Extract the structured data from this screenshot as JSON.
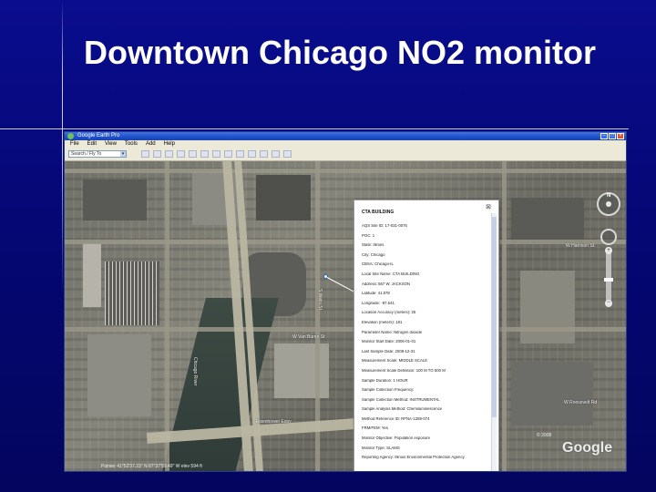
{
  "slide": {
    "title": "Downtown Chicago NO2 monitor"
  },
  "window": {
    "app_title": "Google Earth Pro",
    "menu": [
      "File",
      "Edit",
      "View",
      "Tools",
      "Add",
      "Help"
    ],
    "search_value": "Search / Fly To"
  },
  "map": {
    "labels": {
      "street_left": "S Wells St",
      "street_mid": "W Van Buren St",
      "expressway": "Eisenhower Expy",
      "street_right_top": "W Harrison St",
      "street_right_bottom": "W Roosevelt Rd",
      "river_label": "Chicago River"
    },
    "logo": "Google",
    "copyright": "© 2008",
    "status": "Pointer 41°52'37.23\" N  87°37'59.49\" W  elev 594 ft"
  },
  "balloon": {
    "site_name": "CTA BUILDING",
    "rows": [
      "AQS Site ID: 17-031-0076",
      "POC: 1",
      "State: Illinois",
      "City: Chicago",
      "CBSA: Chicago-IL",
      "Local Site Name: CTA BUILDING",
      "Address: 567 W. JACKSON",
      "Latitude: 41.878",
      "Longitude: -87.641",
      "Location Accuracy (meters): 25",
      "Elevation (meters): 181",
      "Parameter Name: Nitrogen dioxide",
      "Monitor Start Date: 2006-01-01",
      "Last Sample Date: 2008-12-31",
      "Measurement Scale: MIDDLE SCALE",
      "Measurement Scale Definition: 100 M TO 500 M",
      "Sample Duration: 1 HOUR",
      "Sample Collection Frequency:",
      "Sample Collection Method: INSTRUMENTAL",
      "Sample Analysis Method: Chemiluminescence",
      "Method Reference ID: RFNA-1289-074",
      "FRM/FEM: Yes",
      "Monitor Objective: Population exposure",
      "Monitor Type: SLAMS",
      "Reporting Agency: Illinois Environmental Protection Agency"
    ]
  }
}
